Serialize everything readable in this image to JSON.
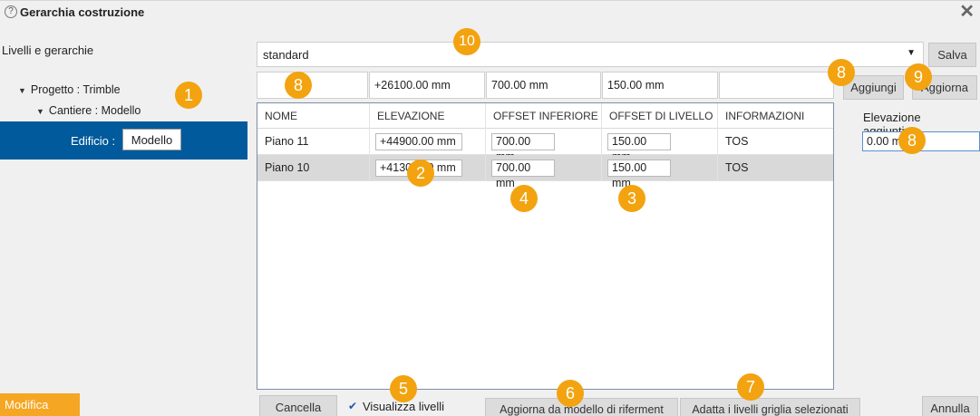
{
  "window": {
    "title": "Gerarchia costruzione",
    "help_icon": "?",
    "close_icon": "✕"
  },
  "left": {
    "heading": "Livelli e gerarchie",
    "tree": {
      "project_label": "Progetto : Trimble",
      "site_label": "Cantiere : Modello",
      "building_prefix": "Edificio :",
      "building_value": "Modello"
    }
  },
  "preset": {
    "value": "standard",
    "save_label": "Salva"
  },
  "new_level": {
    "elevation": "+26100.00 mm",
    "lower_offset": "700.00 mm",
    "level_offset": "150.00 mm",
    "info": ""
  },
  "actions": {
    "add_label": "Aggiungi",
    "update_label": "Aggiorna"
  },
  "table": {
    "headers": [
      "NOME",
      "ELEVAZIONE",
      "OFFSET INFERIORE",
      "OFFSET DI LIVELLO",
      "INFORMAZIONI"
    ],
    "rows": [
      {
        "name": "Piano 11",
        "elevation": "+44900.00 mm",
        "lower_offset": "700.00 mm",
        "level_offset": "150.00 mm",
        "info": "TOS"
      },
      {
        "name": "Piano 10",
        "elevation": "+41300.00 mm",
        "lower_offset": "700.00 mm",
        "level_offset": "150.00 mm",
        "info": "TOS"
      }
    ]
  },
  "extra": {
    "label": "Elevazione aggiuntiva:",
    "value": "0.00 mm"
  },
  "footer": {
    "modify_label": "Modifica",
    "cancel_label": "Cancella",
    "show_levels_label": "Visualizza livelli",
    "show_levels_checked": true,
    "update_from_ref_label": "Aggiorna da modello di riferment",
    "fit_grid_label": "Adatta i livelli griglia selezionati",
    "annul_label": "Annulla"
  },
  "callouts": {
    "b1": "1",
    "b2": "2",
    "b3": "3",
    "b4": "4",
    "b5": "5",
    "b6": "6",
    "b7": "7",
    "b8a": "8",
    "b8b": "8",
    "b8c": "8",
    "b9": "9",
    "b10": "10"
  },
  "colors": {
    "accent": "#f5a623",
    "selection": "#005a9c",
    "callout": "#f2a30f"
  }
}
